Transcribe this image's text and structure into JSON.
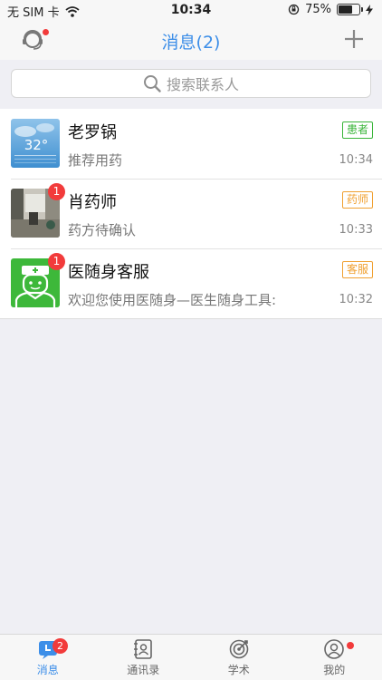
{
  "status_bar": {
    "carrier": "无 SIM 卡",
    "time": "10:34",
    "battery": "75%",
    "battery_level": 0.75
  },
  "nav": {
    "title": "消息(2)"
  },
  "search": {
    "placeholder": "搜索联系人"
  },
  "conversations": [
    {
      "name": "老罗锅",
      "preview": "推荐用药",
      "tag": "患者",
      "time": "10:34",
      "avatar": "weather-avatar",
      "tag_color": "#39b539"
    },
    {
      "name": "肖药师",
      "preview": "药方待确认",
      "tag": "药师",
      "time": "10:33",
      "unread": "1",
      "avatar": "photo-avatar",
      "tag_color": "#f0a030"
    },
    {
      "name": "医随身客服",
      "preview": "欢迎您使用医随身—医生随身工具:",
      "tag": "客服",
      "time": "10:32",
      "unread": "1",
      "avatar": "doctor-avatar",
      "tag_color": "#f0a030"
    }
  ],
  "avatar_text": {
    "temperature": "32°"
  },
  "tabs": [
    {
      "label": "消息",
      "badge": "2",
      "icon": "message-icon",
      "active": true
    },
    {
      "label": "通讯录",
      "icon": "contacts-icon"
    },
    {
      "label": "学术",
      "icon": "academic-icon"
    },
    {
      "label": "我的",
      "icon": "profile-icon"
    }
  ],
  "colors": {
    "accent": "#3c8ee8",
    "badge": "#f23b3b",
    "green_tag": "#39b539",
    "orange_tag": "#f0a030"
  }
}
